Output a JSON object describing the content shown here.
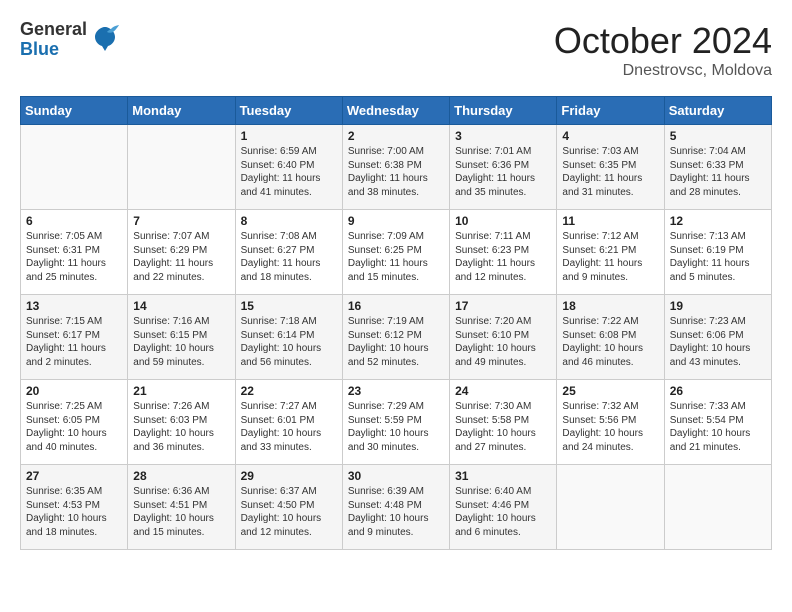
{
  "header": {
    "logo_general": "General",
    "logo_blue": "Blue",
    "month_title": "October 2024",
    "location": "Dnestrovsc, Moldova"
  },
  "days_of_week": [
    "Sunday",
    "Monday",
    "Tuesday",
    "Wednesday",
    "Thursday",
    "Friday",
    "Saturday"
  ],
  "weeks": [
    [
      {
        "day": "",
        "detail": ""
      },
      {
        "day": "",
        "detail": ""
      },
      {
        "day": "1",
        "detail": "Sunrise: 6:59 AM\nSunset: 6:40 PM\nDaylight: 11 hours\nand 41 minutes."
      },
      {
        "day": "2",
        "detail": "Sunrise: 7:00 AM\nSunset: 6:38 PM\nDaylight: 11 hours\nand 38 minutes."
      },
      {
        "day": "3",
        "detail": "Sunrise: 7:01 AM\nSunset: 6:36 PM\nDaylight: 11 hours\nand 35 minutes."
      },
      {
        "day": "4",
        "detail": "Sunrise: 7:03 AM\nSunset: 6:35 PM\nDaylight: 11 hours\nand 31 minutes."
      },
      {
        "day": "5",
        "detail": "Sunrise: 7:04 AM\nSunset: 6:33 PM\nDaylight: 11 hours\nand 28 minutes."
      }
    ],
    [
      {
        "day": "6",
        "detail": "Sunrise: 7:05 AM\nSunset: 6:31 PM\nDaylight: 11 hours\nand 25 minutes."
      },
      {
        "day": "7",
        "detail": "Sunrise: 7:07 AM\nSunset: 6:29 PM\nDaylight: 11 hours\nand 22 minutes."
      },
      {
        "day": "8",
        "detail": "Sunrise: 7:08 AM\nSunset: 6:27 PM\nDaylight: 11 hours\nand 18 minutes."
      },
      {
        "day": "9",
        "detail": "Sunrise: 7:09 AM\nSunset: 6:25 PM\nDaylight: 11 hours\nand 15 minutes."
      },
      {
        "day": "10",
        "detail": "Sunrise: 7:11 AM\nSunset: 6:23 PM\nDaylight: 11 hours\nand 12 minutes."
      },
      {
        "day": "11",
        "detail": "Sunrise: 7:12 AM\nSunset: 6:21 PM\nDaylight: 11 hours\nand 9 minutes."
      },
      {
        "day": "12",
        "detail": "Sunrise: 7:13 AM\nSunset: 6:19 PM\nDaylight: 11 hours\nand 5 minutes."
      }
    ],
    [
      {
        "day": "13",
        "detail": "Sunrise: 7:15 AM\nSunset: 6:17 PM\nDaylight: 11 hours\nand 2 minutes."
      },
      {
        "day": "14",
        "detail": "Sunrise: 7:16 AM\nSunset: 6:15 PM\nDaylight: 10 hours\nand 59 minutes."
      },
      {
        "day": "15",
        "detail": "Sunrise: 7:18 AM\nSunset: 6:14 PM\nDaylight: 10 hours\nand 56 minutes."
      },
      {
        "day": "16",
        "detail": "Sunrise: 7:19 AM\nSunset: 6:12 PM\nDaylight: 10 hours\nand 52 minutes."
      },
      {
        "day": "17",
        "detail": "Sunrise: 7:20 AM\nSunset: 6:10 PM\nDaylight: 10 hours\nand 49 minutes."
      },
      {
        "day": "18",
        "detail": "Sunrise: 7:22 AM\nSunset: 6:08 PM\nDaylight: 10 hours\nand 46 minutes."
      },
      {
        "day": "19",
        "detail": "Sunrise: 7:23 AM\nSunset: 6:06 PM\nDaylight: 10 hours\nand 43 minutes."
      }
    ],
    [
      {
        "day": "20",
        "detail": "Sunrise: 7:25 AM\nSunset: 6:05 PM\nDaylight: 10 hours\nand 40 minutes."
      },
      {
        "day": "21",
        "detail": "Sunrise: 7:26 AM\nSunset: 6:03 PM\nDaylight: 10 hours\nand 36 minutes."
      },
      {
        "day": "22",
        "detail": "Sunrise: 7:27 AM\nSunset: 6:01 PM\nDaylight: 10 hours\nand 33 minutes."
      },
      {
        "day": "23",
        "detail": "Sunrise: 7:29 AM\nSunset: 5:59 PM\nDaylight: 10 hours\nand 30 minutes."
      },
      {
        "day": "24",
        "detail": "Sunrise: 7:30 AM\nSunset: 5:58 PM\nDaylight: 10 hours\nand 27 minutes."
      },
      {
        "day": "25",
        "detail": "Sunrise: 7:32 AM\nSunset: 5:56 PM\nDaylight: 10 hours\nand 24 minutes."
      },
      {
        "day": "26",
        "detail": "Sunrise: 7:33 AM\nSunset: 5:54 PM\nDaylight: 10 hours\nand 21 minutes."
      }
    ],
    [
      {
        "day": "27",
        "detail": "Sunrise: 6:35 AM\nSunset: 4:53 PM\nDaylight: 10 hours\nand 18 minutes."
      },
      {
        "day": "28",
        "detail": "Sunrise: 6:36 AM\nSunset: 4:51 PM\nDaylight: 10 hours\nand 15 minutes."
      },
      {
        "day": "29",
        "detail": "Sunrise: 6:37 AM\nSunset: 4:50 PM\nDaylight: 10 hours\nand 12 minutes."
      },
      {
        "day": "30",
        "detail": "Sunrise: 6:39 AM\nSunset: 4:48 PM\nDaylight: 10 hours\nand 9 minutes."
      },
      {
        "day": "31",
        "detail": "Sunrise: 6:40 AM\nSunset: 4:46 PM\nDaylight: 10 hours\nand 6 minutes."
      },
      {
        "day": "",
        "detail": ""
      },
      {
        "day": "",
        "detail": ""
      }
    ]
  ]
}
